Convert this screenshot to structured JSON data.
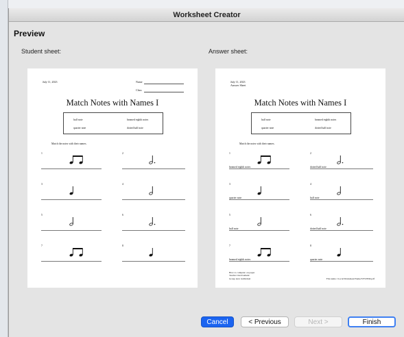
{
  "window": {
    "title": "Worksheet Creator"
  },
  "preview": {
    "title": "Preview",
    "student_label": "Student sheet:",
    "answer_label": "Answer sheet:"
  },
  "worksheet": {
    "date": "July 11, 2023",
    "answer_sheet_label": "Answer Sheet",
    "name_label": "Name",
    "class_label": "Class",
    "title": "Match Notes with Names I",
    "word_bank": [
      "half note",
      "beamed eighth notes",
      "quarter note",
      "dotted half note"
    ],
    "instruction": "Match the notes with their names.",
    "questions": [
      {
        "num": "1",
        "note": "beamed-eighth-notes-icon",
        "answer": "beamed eighth notes"
      },
      {
        "num": "2",
        "note": "dotted-half-note-icon",
        "answer": "dotted half note"
      },
      {
        "num": "3",
        "note": "quarter-note-icon",
        "answer": "quarter note"
      },
      {
        "num": "4",
        "note": "half-note-icon",
        "answer": "half note"
      },
      {
        "num": "5",
        "note": "half-note-icon",
        "answer": "half note"
      },
      {
        "num": "6",
        "note": "dotted-half-note-icon",
        "answer": "dotted half note"
      },
      {
        "num": "7",
        "note": "beamed-eighth-notes-icon",
        "answer": "beamed eighth notes"
      },
      {
        "num": "8",
        "note": "quarter-note-icon",
        "answer": "quarter note"
      }
    ],
    "footer_left": [
      "How to compute: on paper",
      "Teacher involvement:",
      "Group size: individual"
    ],
    "footer_right": "File name: /Local/Worksheet/Name/SYSTEM.pdf"
  },
  "buttons": {
    "cancel": "Cancel",
    "previous": "< Previous",
    "next": "Next >",
    "finish": "Finish"
  },
  "colors": {
    "accent": "#1b64f0",
    "window_bg": "#e4e4e4"
  }
}
